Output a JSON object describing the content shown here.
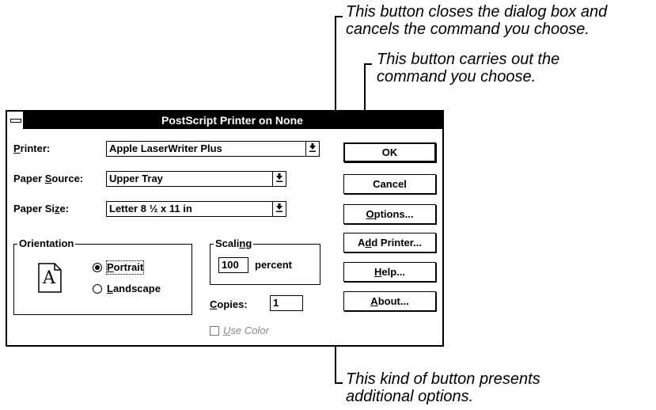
{
  "callouts": {
    "cancel": [
      "This button closes the dialog box and",
      "cancels the command you choose."
    ],
    "ok": [
      "This button carries out the",
      "command you choose."
    ],
    "options": [
      "This kind of button presents",
      "additional options."
    ]
  },
  "dialog": {
    "title": "PostScript Printer on None",
    "printer": {
      "label_pre": "",
      "label_ul": "P",
      "label_post": "rinter:",
      "value": "Apple LaserWriter Plus"
    },
    "paper_source": {
      "label_pre": "Paper ",
      "label_ul": "S",
      "label_post": "ource:",
      "value": "Upper Tray"
    },
    "paper_size": {
      "label_pre": "Paper Si",
      "label_ul": "z",
      "label_post": "e:",
      "value": "Letter 8 ½ x 11 in"
    },
    "orientation": {
      "title": "Orientation",
      "icon_letter": "A",
      "portrait_pre": "",
      "portrait_ul": "P",
      "portrait_post": "ortrait",
      "landscape_pre": "",
      "landscape_ul": "L",
      "landscape_post": "andscape",
      "selected": "portrait"
    },
    "scaling": {
      "title_pre": "Scali",
      "title_ul": "n",
      "title_post": "g",
      "value": "100",
      "unit": "percent"
    },
    "copies": {
      "label_pre": "",
      "label_ul": "C",
      "label_post": "opies:",
      "value": "1"
    },
    "use_color": {
      "label_pre": "",
      "label_ul": "U",
      "label_post": "se Color",
      "checked": false
    },
    "buttons": {
      "ok": "OK",
      "cancel": "Cancel",
      "options_pre": "",
      "options_ul": "O",
      "options_post": "ptions...",
      "add_printer_pre": "A",
      "add_printer_ul": "d",
      "add_printer_post": "d Printer...",
      "help_pre": "",
      "help_ul": "H",
      "help_post": "elp...",
      "about_pre": "",
      "about_ul": "A",
      "about_post": "bout..."
    },
    "dropdown_icon": "down-arrow-underline-icon"
  }
}
